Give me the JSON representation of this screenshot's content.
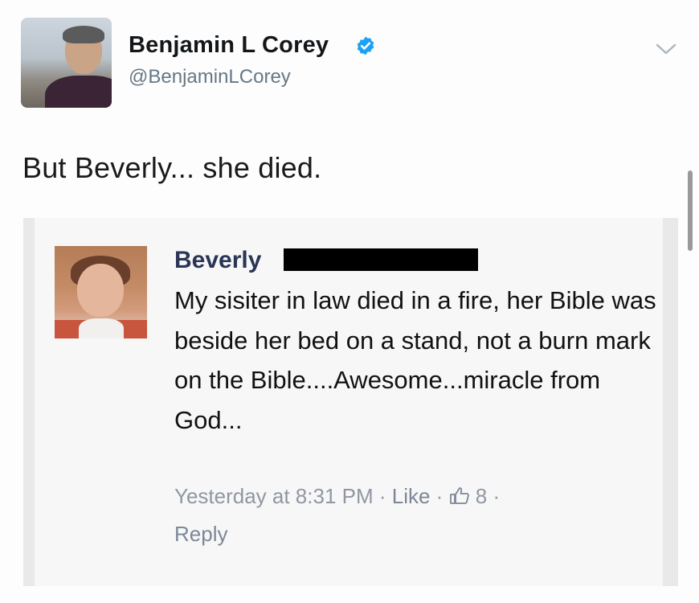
{
  "tweet": {
    "author": {
      "display_name": "Benjamin L Corey",
      "handle": "@BenjaminLCorey",
      "verified": true
    },
    "text": "But Beverly... she died."
  },
  "embedded_comment": {
    "name": "Beverly",
    "body": "My sisiter in law died in a fire, her Bible was beside her bed on a stand, not a burn mark on the Bible....Awesome...miracle from God...",
    "timestamp": "Yesterday at 8:31 PM",
    "separator": " · ",
    "like_label": "Like",
    "like_count": "8",
    "reply_label": "Reply"
  },
  "icons": {
    "verified": "verified-badge-icon",
    "menu": "chevron-down-icon",
    "like": "thumbs-up-icon"
  },
  "colors": {
    "verified": "#1da1f2",
    "handle": "#657786",
    "fb_name": "#2a3557",
    "fb_meta": "#9097a3"
  }
}
